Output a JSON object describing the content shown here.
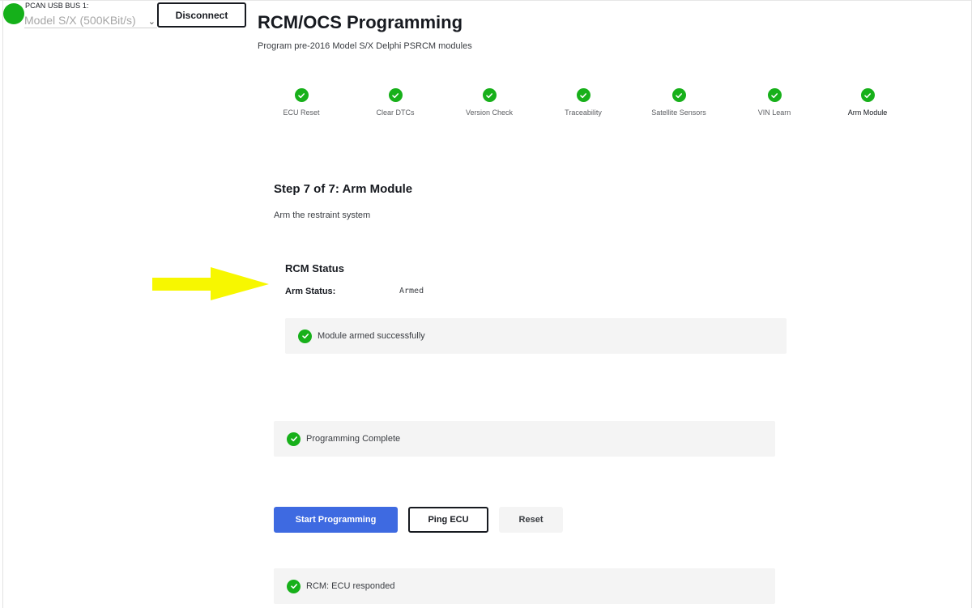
{
  "connection": {
    "status_color": "#15b01a",
    "bus_label": "PCAN USB BUS 1:",
    "bus_selected": "Model S/X (500KBit/s)",
    "chevron_icon": "chevron-down-icon",
    "disconnect_label": "Disconnect"
  },
  "header": {
    "title": "RCM/OCS Programming",
    "subtitle": "Program pre-2016 Model S/X Delphi PSRCM modules"
  },
  "stepper": {
    "steps": [
      {
        "label": "ECU Reset",
        "status": "complete"
      },
      {
        "label": "Clear DTCs",
        "status": "complete"
      },
      {
        "label": "Version Check",
        "status": "complete"
      },
      {
        "label": "Traceability",
        "status": "complete"
      },
      {
        "label": "Satellite Sensors",
        "status": "complete"
      },
      {
        "label": "VIN Learn",
        "status": "complete"
      },
      {
        "label": "Arm Module",
        "status": "complete",
        "active": true
      }
    ],
    "complete_color": "#17b01a"
  },
  "step": {
    "title": "Step 7 of 7: Arm Module",
    "description": "Arm the restraint system"
  },
  "rcm_status": {
    "title": "RCM Status",
    "arm_label": "Arm Status:",
    "arm_value": "Armed",
    "armed_message": "Module armed successfully"
  },
  "programming": {
    "complete_message": "Programming Complete"
  },
  "actions": {
    "start_label": "Start Programming",
    "ping_label": "Ping ECU",
    "reset_label": "Reset",
    "accent_color": "#3e6ae1"
  },
  "ping_result": {
    "message": "RCM: ECU responded"
  },
  "annotation": {
    "arrow_color": "#f7f700",
    "arrow_icon": "arrow-right-icon"
  }
}
